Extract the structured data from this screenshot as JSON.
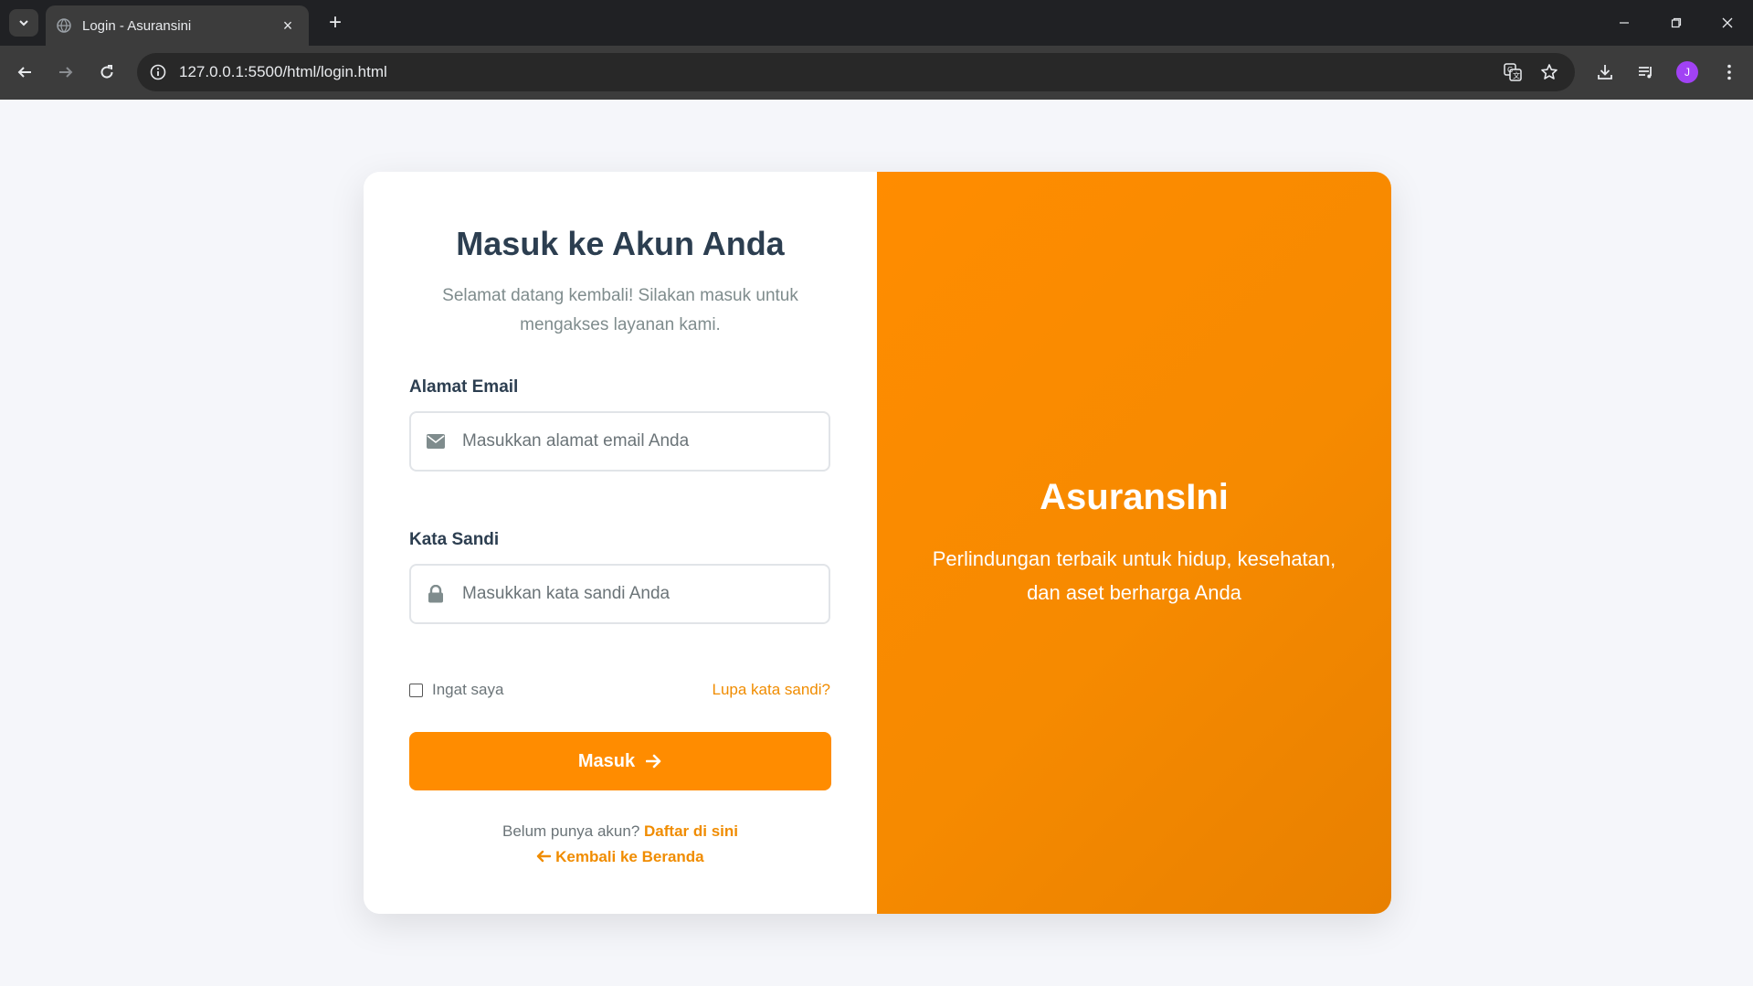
{
  "browser": {
    "tab_title": "Login - Asuransini",
    "url": "127.0.0.1:5500/html/login.html",
    "profile_initial": "J"
  },
  "login": {
    "heading": "Masuk ke Akun Anda",
    "subtitle": "Selamat datang kembali! Silakan masuk untuk mengakses layanan kami.",
    "email_label": "Alamat Email",
    "email_placeholder": "Masukkan alamat email Anda",
    "password_label": "Kata Sandi",
    "password_placeholder": "Masukkan kata sandi Anda",
    "remember_label": "Ingat saya",
    "forgot_label": "Lupa kata sandi?",
    "submit_label": "Masuk",
    "no_account_text": "Belum punya akun?",
    "register_link": "Daftar di sini",
    "back_link": "Kembali ke Beranda"
  },
  "promo": {
    "brand": "AsuransIni",
    "tagline": "Perlindungan terbaik untuk hidup, kesehatan, dan aset berharga Anda"
  },
  "colors": {
    "accent": "#ff8c00",
    "heading": "#2c3e50",
    "muted": "#7f8c8d",
    "page_bg": "#f5f6fa"
  }
}
